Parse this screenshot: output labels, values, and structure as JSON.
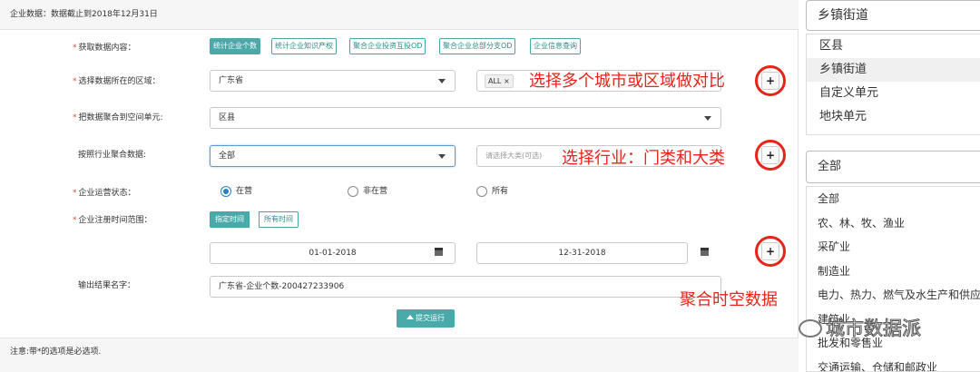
{
  "header": {
    "title": "企业数据：数据截止到2018年12月31日"
  },
  "footer": {
    "note": "注意:带*的选项是必选项."
  },
  "form": {
    "required_mark": "*",
    "fetch": {
      "label": "获取数据内容：",
      "options": [
        "统计企业个数",
        "统计企业知识产权",
        "聚合企业投资互投OD",
        "聚合企业总部分支OD",
        "企业信息查询"
      ],
      "selected_index": 0
    },
    "region": {
      "label": "选择数据所在的区域：",
      "province": "广东省",
      "city_tag": "ALL",
      "city_tag_remove": "×"
    },
    "aggregate": {
      "label": "把数据聚合到空间单元:",
      "value": "区县"
    },
    "industry": {
      "label": "按照行业聚合数据:",
      "value": "全部",
      "sub_placeholder": "请选择大类(可选)"
    },
    "status": {
      "label": "企业运营状态：",
      "options": [
        "在营",
        "非在营",
        "所有"
      ],
      "selected": "在营"
    },
    "time_range": {
      "label": "企业注册时间范围：",
      "options": [
        "指定时间",
        "所有时间"
      ],
      "selected": "指定时间"
    },
    "dates": {
      "start": "01-01-2018",
      "end": "12-31-2018"
    },
    "output": {
      "label": "输出结果名字：",
      "value": "广东省-企业个数-200427233906"
    },
    "submit_label": "提交运行",
    "plus_label": "+"
  },
  "annotations": {
    "region": "选择多个城市或区域做对比",
    "industry": "选择行业：门类和大类",
    "time": "聚合时空数据"
  },
  "dropdown_unit": {
    "input_value": "乡镇街道",
    "items": [
      "区县",
      "乡镇街道",
      "自定义单元",
      "地块单元"
    ],
    "highlighted": "乡镇街道"
  },
  "dropdown_industry": {
    "input_value": "全部",
    "items": [
      "全部",
      "农、林、牧、渔业",
      "采矿业",
      "制造业",
      "电力、热力、燃气及水生产和供应业",
      "建筑业",
      "批发和零售业",
      "交通运输、仓储和邮政业"
    ]
  },
  "watermark": "城市数据派",
  "colors": {
    "accent": "#4aa9a9",
    "annotation": "#e8231a",
    "radio": "#2c7fb8"
  }
}
